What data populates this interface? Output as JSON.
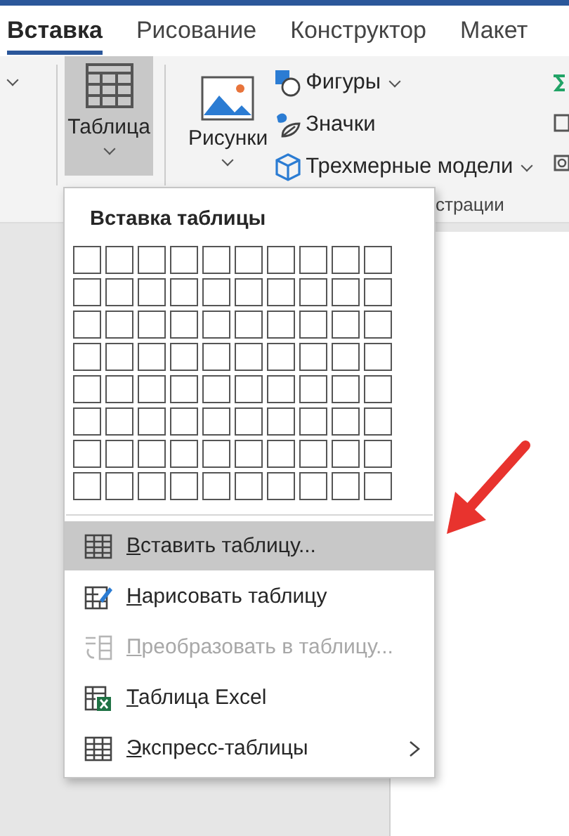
{
  "tabs": [
    {
      "label": "Вставка",
      "selected": true
    },
    {
      "label": "Рисование",
      "selected": false
    },
    {
      "label": "Конструктор",
      "selected": false
    },
    {
      "label": "Макет",
      "selected": false
    }
  ],
  "ribbon": {
    "table_button": {
      "label": "Таблица",
      "expanded": true
    },
    "pictures_button": {
      "label": "Рисунки"
    },
    "items": [
      {
        "label": "Фигуры",
        "dropdown": true
      },
      {
        "label": "Значки",
        "dropdown": false
      },
      {
        "label": "Трехмерные модели",
        "dropdown": true
      }
    ],
    "group_label": "страции"
  },
  "menu": {
    "title": "Вставка таблицы",
    "items": [
      {
        "label": "Вставить таблицу...",
        "kind": "table",
        "selected": true,
        "disabled": false,
        "submenu": false
      },
      {
        "label": "Нарисовать таблицу",
        "kind": "draw",
        "selected": false,
        "disabled": false,
        "submenu": false
      },
      {
        "label": "Преобразовать в таблицу...",
        "kind": "convert",
        "selected": false,
        "disabled": true,
        "submenu": false
      },
      {
        "label": "Таблица Excel",
        "kind": "excel",
        "selected": false,
        "disabled": false,
        "submenu": false
      },
      {
        "label": "Экспресс-таблицы",
        "kind": "table",
        "selected": false,
        "disabled": false,
        "submenu": true
      }
    ]
  }
}
